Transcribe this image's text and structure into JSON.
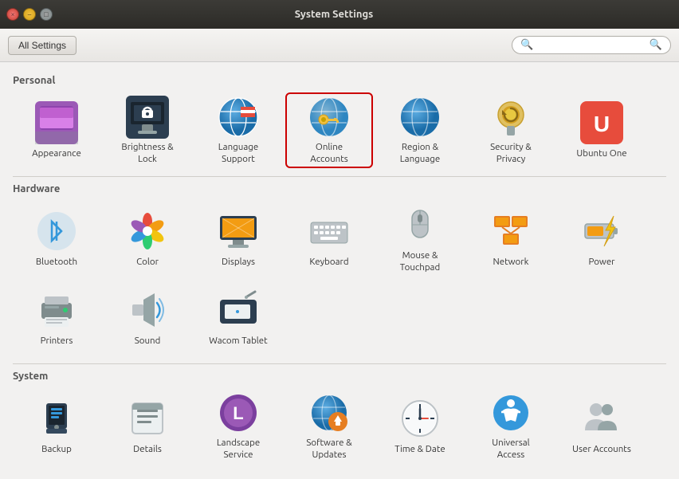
{
  "titlebar": {
    "title": "System Settings",
    "close_label": "×",
    "min_label": "–",
    "max_label": "□"
  },
  "toolbar": {
    "all_settings_label": "All Settings",
    "search_placeholder": ""
  },
  "sections": [
    {
      "id": "personal",
      "label": "Personal",
      "items": [
        {
          "id": "appearance",
          "label": "Appearance",
          "selected": false
        },
        {
          "id": "brightness-lock",
          "label": "Brightness &\nLock",
          "selected": false
        },
        {
          "id": "language-support",
          "label": "Language\nSupport",
          "selected": false
        },
        {
          "id": "online-accounts",
          "label": "Online\nAccounts",
          "selected": true
        },
        {
          "id": "region-language",
          "label": "Region &\nLanguage",
          "selected": false
        },
        {
          "id": "security-privacy",
          "label": "Security &\nPrivacy",
          "selected": false
        },
        {
          "id": "ubuntu-one",
          "label": "Ubuntu One",
          "selected": false
        }
      ]
    },
    {
      "id": "hardware",
      "label": "Hardware",
      "items": [
        {
          "id": "bluetooth",
          "label": "Bluetooth",
          "selected": false
        },
        {
          "id": "color",
          "label": "Color",
          "selected": false
        },
        {
          "id": "displays",
          "label": "Displays",
          "selected": false
        },
        {
          "id": "keyboard",
          "label": "Keyboard",
          "selected": false
        },
        {
          "id": "mouse-touchpad",
          "label": "Mouse &\nTouchpad",
          "selected": false
        },
        {
          "id": "network",
          "label": "Network",
          "selected": false
        },
        {
          "id": "power",
          "label": "Power",
          "selected": false
        },
        {
          "id": "printers",
          "label": "Printers",
          "selected": false
        },
        {
          "id": "sound",
          "label": "Sound",
          "selected": false
        },
        {
          "id": "wacom-tablet",
          "label": "Wacom Tablet",
          "selected": false
        }
      ]
    },
    {
      "id": "system",
      "label": "System",
      "items": [
        {
          "id": "backup",
          "label": "Backup",
          "selected": false
        },
        {
          "id": "details",
          "label": "Details",
          "selected": false
        },
        {
          "id": "landscape-service",
          "label": "Landscape\nService",
          "selected": false
        },
        {
          "id": "software-updates",
          "label": "Software &\nUpdates",
          "selected": false
        },
        {
          "id": "time-date",
          "label": "Time & Date",
          "selected": false
        },
        {
          "id": "universal-access",
          "label": "Universal\nAccess",
          "selected": false
        },
        {
          "id": "user-accounts",
          "label": "User Accounts",
          "selected": false
        }
      ]
    }
  ]
}
